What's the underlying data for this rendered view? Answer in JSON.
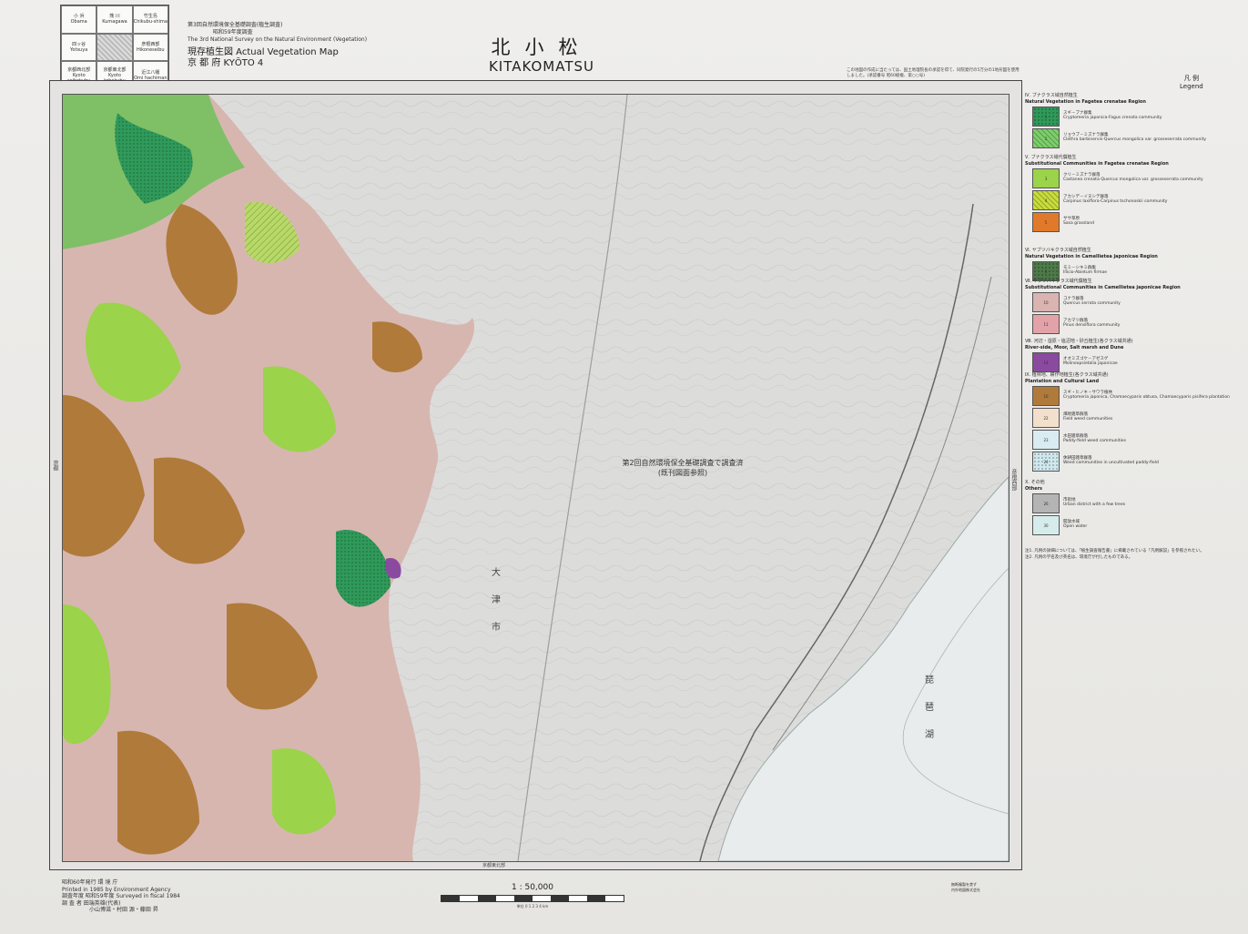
{
  "index_sheet": {
    "cells": [
      {
        "jp": "小 浜",
        "ro": "Obama"
      },
      {
        "jp": "熊 川",
        "ro": "Kumagawa"
      },
      {
        "jp": "竹生島",
        "ro": "Chikubu-shima"
      },
      {
        "jp": "四ッ谷",
        "ro": "Yotsuya"
      },
      {
        "jp": "",
        "ro": ""
      },
      {
        "jp": "彦根西部",
        "ro": "Hikoneseibu"
      },
      {
        "jp": "京都西北部",
        "ro": "Kyoto seihokubu"
      },
      {
        "jp": "京都東北部",
        "ro": "Kyoto tohokubu"
      },
      {
        "jp": "近江八幡",
        "ro": "Omi hachiman"
      }
    ]
  },
  "header": {
    "line1": "第3回自然環境保全基礎調査(植生調査)",
    "line2": "昭和59年度調査",
    "line3": "The 3rd National Survey on the Natural Environment (Vegetation)",
    "map_title": "現存植生図 Actual Vegetation Map",
    "prefecture": "京 都 府 KYŌTO 4"
  },
  "title": {
    "jp": "北小松",
    "romaji": "KITAKOMATSU"
  },
  "top_note": "この地図の作成に当たっては、国土地理院長の承認を得て、同院発行の5万分の1地形図を使用しました。(承認番号 昭60総複、第○○号)",
  "map": {
    "center_note_line1": "第2回自然環境保全基礎調査で調査済",
    "center_note_line2": "(既刊図面参照)",
    "left_margin_label": "京都",
    "right_margin_label": "彦根西部",
    "bottom_margin_label": "京都東北部",
    "lake_label_1": "琵",
    "lake_label_2": "琶",
    "lake_label_3": "湖",
    "city_label_1": "大",
    "city_label_2": "津",
    "city_label_3": "市"
  },
  "legend": {
    "title_jp": "凡 例",
    "title_en": "Legend",
    "groups": [
      {
        "jp": "Ⅳ. ブナクラス域自然植生",
        "en": "Natural Vegetation in Fagetea crenatae Region",
        "items": [
          {
            "code": "1",
            "color": "#2f9a5a",
            "pattern": "dots",
            "jp": "スギ－ブナ群集",
            "en": "Cryptomeria japonica-Fagus crenata community"
          },
          {
            "code": "2",
            "color": "#7ccf6a",
            "pattern": "hatch",
            "jp": "リョウブ－ミズナラ群集",
            "en": "Clethra barbinervis-Quercus mongolica var. grosseserrata community"
          }
        ]
      },
      {
        "jp": "Ⅴ. ブナクラス域代償植生",
        "en": "Substitutional Communities in Fagetea crenatae Region",
        "items": [
          {
            "code": "3",
            "color": "#9bd34a",
            "pattern": "none",
            "jp": "クリ－ミズナラ群落",
            "en": "Castanea crenata-Quercus mongolica var. grosseserrata community"
          },
          {
            "code": "4",
            "color": "#c8dc3c",
            "pattern": "hatch",
            "jp": "アカシデ－イヌシデ群落",
            "en": "Carpinus laxiflora-Carpinus tschonoskii community"
          },
          {
            "code": "5",
            "color": "#e07a2a",
            "pattern": "none",
            "jp": "ササ草原",
            "en": "Sasa grassland"
          }
        ]
      },
      {
        "jp": "Ⅵ. ヤブツバキクラス域自然植生",
        "en": "Natural Vegetation in Camellietea japonicae Region",
        "items": [
          {
            "code": "6",
            "color": "#4d7a48",
            "pattern": "dots",
            "jp": "モミ－シキミ群集",
            "en": "Illicio-Abietum firmae"
          }
        ]
      },
      {
        "jp": "Ⅶ. ヤブツバキクラス域代償植生",
        "en": "Substitutional Communities in Camellietea japonicae Region",
        "items": [
          {
            "code": "10",
            "color": "#d9b4b0",
            "pattern": "none",
            "jp": "コナラ群落",
            "en": "Quercus serrata community"
          },
          {
            "code": "11",
            "color": "#e2a2a8",
            "pattern": "none",
            "jp": "アカマツ群落",
            "en": "Pinus densiflora community"
          }
        ]
      },
      {
        "jp": "Ⅷ. 河辺・湿原・塩沼地・砂丘植生(各クラス域共通)",
        "en": "River-side, Moor, Salt marsh and Dune",
        "items": [
          {
            "code": "14",
            "color": "#8a4aa0",
            "pattern": "none",
            "jp": "オオミズゴケ－アゼスゲ",
            "en": "Molineopsietalia japonicae"
          }
        ]
      },
      {
        "jp": "Ⅸ. 植林地、耕作地植生(各クラス域共通)",
        "en": "Plantation and Cultural Land",
        "items": [
          {
            "code": "16",
            "color": "#b07a3a",
            "pattern": "none",
            "jp": "スギ・ヒノキ・サワラ植林",
            "en": "Cryptomeria japonica, Chamaecyparis obtusa, Chamaecyparis pisifera plantation"
          },
          {
            "code": "22",
            "color": "#f2e0cc",
            "pattern": "none",
            "jp": "畑地雑草群落",
            "en": "Field weed communities"
          },
          {
            "code": "23",
            "color": "#d8ecf2",
            "pattern": "none",
            "jp": "水田雑草群落",
            "en": "Paddy-field weed communities"
          },
          {
            "code": "24",
            "color": "#cfe8ee",
            "pattern": "dots",
            "jp": "休耕田雑草群落",
            "en": "Weed communities in uncultivated paddy-field"
          }
        ]
      },
      {
        "jp": "Ⅹ. その他",
        "en": "Others",
        "items": [
          {
            "code": "26",
            "color": "#b4b4b4",
            "pattern": "none",
            "jp": "市街地",
            "en": "Urban district with a few trees"
          },
          {
            "code": "30",
            "color": "#d6ecec",
            "pattern": "none",
            "jp": "開放水域",
            "en": "Open water"
          }
        ]
      }
    ],
    "note1": "注1. 凡例の詳細については、「植生調査報告書」に掲載されている「凡例解説」を参照されたい。",
    "note2": "注2. 凡例の学名及び英名は、環境庁が付したものである。"
  },
  "footer": {
    "left_line1": "昭和60年発行   環 境 庁",
    "left_line2": "Printed in 1985 by Environment Agency",
    "left_line3": "調査年度 昭和59年度   Surveyed in fiscal 1984",
    "left_line4": "調 査 者 田端英雄(代表)",
    "left_line5": "小山博滋・村田 源・藤田 昇",
    "scale": "1 : 50,000",
    "scale_sub": "単位 0  1  2  3  4 km",
    "right_line1": "無断複製を禁ず",
    "right_line2": "内外地図株式会社"
  }
}
